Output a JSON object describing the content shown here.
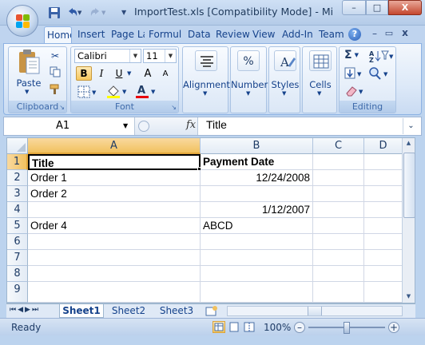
{
  "window": {
    "title": "ImportTest.xls  [Compatibility Mode] - Mi",
    "minimize": "–",
    "maximize": "□",
    "close": "X"
  },
  "quick_access": {
    "icons": [
      "save-icon",
      "undo-icon",
      "redo-icon",
      "customize-icon"
    ]
  },
  "tabs": [
    "Home",
    "Insert",
    "Page La",
    "Formul",
    "Data",
    "Review",
    "View",
    "Add-In",
    "Team"
  ],
  "active_tab": "Home",
  "ribbon": {
    "clipboard": {
      "label": "Clipboard",
      "paste": "Paste"
    },
    "font": {
      "label": "Font",
      "name": "Calibri",
      "size": "11",
      "bold": "B",
      "italic": "I",
      "underline": "U",
      "grow": "A",
      "shrink": "A",
      "font_color": "A"
    },
    "alignment": {
      "label": "Alignment"
    },
    "number": {
      "label": "Number",
      "glyph": "%"
    },
    "styles": {
      "label": "Styles"
    },
    "cells": {
      "label": "Cells"
    },
    "editing": {
      "label": "Editing",
      "sum": "Σ"
    }
  },
  "formula_bar": {
    "name_box": "A1",
    "fx": "fx",
    "content": "Title"
  },
  "columns": [
    "A",
    "B",
    "C",
    "D"
  ],
  "selected_column": "A",
  "rows": [
    "1",
    "2",
    "3",
    "4",
    "5",
    "6",
    "7",
    "8",
    "9"
  ],
  "selected_row": "1",
  "cells": [
    {
      "a": "Title",
      "b": "Payment Date"
    },
    {
      "a": "Order 1",
      "b": "12/24/2008"
    },
    {
      "a": "Order 2",
      "b": ""
    },
    {
      "a": "",
      "b": "1/12/2007"
    },
    {
      "a": "Order 4",
      "b": "ABCD"
    },
    {
      "a": "",
      "b": ""
    },
    {
      "a": "",
      "b": ""
    },
    {
      "a": "",
      "b": ""
    },
    {
      "a": "",
      "b": ""
    }
  ],
  "sheets": [
    "Sheet1",
    "Sheet2",
    "Sheet3"
  ],
  "active_sheet": "Sheet1",
  "status": {
    "text": "Ready",
    "zoom": "100%",
    "zoom_level": 1.0
  },
  "colors": {
    "accent": "#15428b",
    "selection": "#f1c15f",
    "ribbon": "#dde9f8"
  }
}
